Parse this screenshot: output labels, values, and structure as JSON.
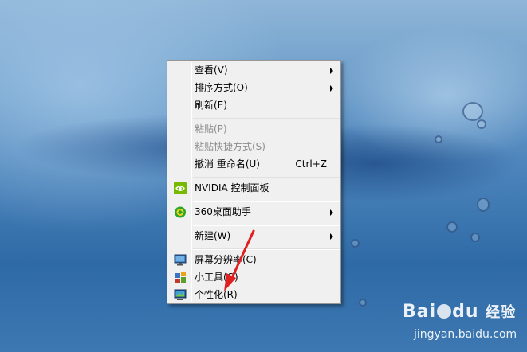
{
  "context_menu": {
    "items": [
      {
        "label": "查看(V)",
        "submenu": true,
        "disabled": false
      },
      {
        "label": "排序方式(O)",
        "submenu": true,
        "disabled": false
      },
      {
        "label": "刷新(E)",
        "submenu": false,
        "disabled": false
      },
      {
        "label": "粘贴(P)",
        "submenu": false,
        "disabled": true
      },
      {
        "label": "粘贴快捷方式(S)",
        "submenu": false,
        "disabled": true
      },
      {
        "label": "撤消 重命名(U)",
        "shortcut": "Ctrl+Z",
        "submenu": false,
        "disabled": false
      },
      {
        "label": "NVIDIA 控制面板",
        "icon": "nvidia-icon",
        "submenu": false,
        "disabled": false
      },
      {
        "label": "360桌面助手",
        "icon": "360-icon",
        "submenu": true,
        "disabled": false
      },
      {
        "label": "新建(W)",
        "submenu": true,
        "disabled": false
      },
      {
        "label": "屏幕分辨率(C)",
        "icon": "display-icon",
        "submenu": false,
        "disabled": false
      },
      {
        "label": "小工具(G)",
        "icon": "gadgets-icon",
        "submenu": false,
        "disabled": false
      },
      {
        "label": "个性化(R)",
        "icon": "personalize-icon",
        "submenu": false,
        "disabled": false
      }
    ]
  },
  "watermark": {
    "brand": "Bai",
    "brand_suffix": "du",
    "product": "经验",
    "url": "jingyan.baidu.com"
  },
  "colors": {
    "menu_bg": "#f0f0f0",
    "disabled_text": "#8d8d8d",
    "annotation_arrow": "#e02020"
  }
}
